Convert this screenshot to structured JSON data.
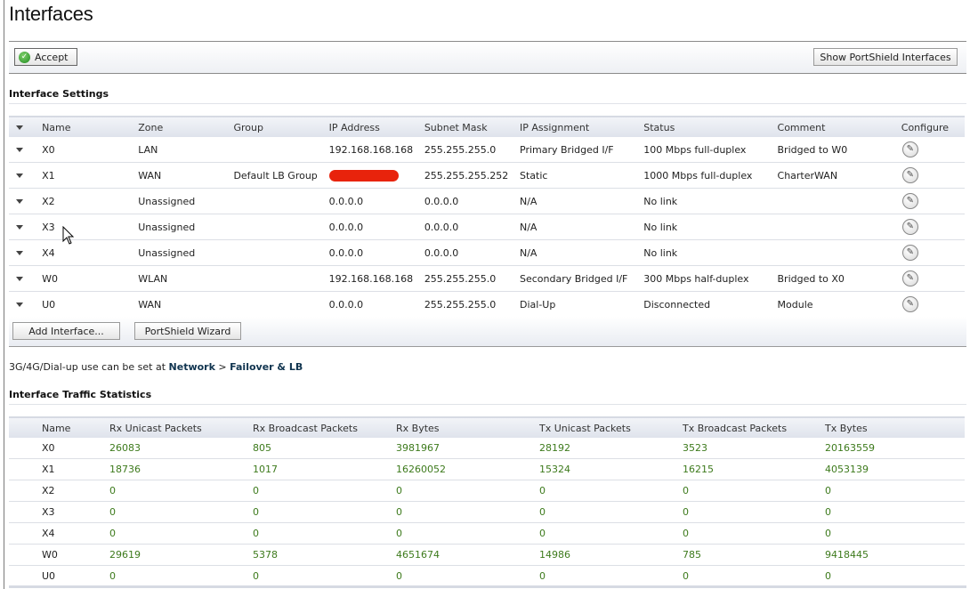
{
  "page": {
    "title": "Interfaces"
  },
  "toolbar": {
    "accept_label": "Accept",
    "show_portshield_label": "Show PortShield Interfaces"
  },
  "interface_settings": {
    "section_title": "Interface Settings",
    "columns": [
      "Name",
      "Zone",
      "Group",
      "IP Address",
      "Subnet Mask",
      "IP Assignment",
      "Status",
      "Comment",
      "Configure"
    ],
    "rows": [
      {
        "name": "X0",
        "zone": "LAN",
        "group": "",
        "ip": "192.168.168.168",
        "mask": "255.255.255.0",
        "assignment": "Primary Bridged I/F",
        "status": "100 Mbps full-duplex",
        "comment": "Bridged to W0"
      },
      {
        "name": "X1",
        "zone": "WAN",
        "group": "Default LB Group",
        "ip": "",
        "ip_redacted": true,
        "mask": "255.255.255.252",
        "assignment": "Static",
        "status": "1000 Mbps full-duplex",
        "comment": "CharterWAN"
      },
      {
        "name": "X2",
        "zone": "Unassigned",
        "group": "",
        "ip": "0.0.0.0",
        "mask": "0.0.0.0",
        "assignment": "N/A",
        "status": "No link",
        "comment": ""
      },
      {
        "name": "X3",
        "zone": "Unassigned",
        "group": "",
        "ip": "0.0.0.0",
        "mask": "0.0.0.0",
        "assignment": "N/A",
        "status": "No link",
        "comment": ""
      },
      {
        "name": "X4",
        "zone": "Unassigned",
        "group": "",
        "ip": "0.0.0.0",
        "mask": "0.0.0.0",
        "assignment": "N/A",
        "status": "No link",
        "comment": ""
      },
      {
        "name": "W0",
        "zone": "WLAN",
        "group": "",
        "ip": "192.168.168.168",
        "mask": "255.255.255.0",
        "assignment": "Secondary Bridged I/F",
        "status": "300 Mbps half-duplex",
        "comment": "Bridged to X0"
      },
      {
        "name": "U0",
        "zone": "WAN",
        "group": "",
        "ip": "0.0.0.0",
        "mask": "255.255.255.0",
        "assignment": "Dial-Up",
        "status": "Disconnected",
        "comment": "Module"
      }
    ],
    "add_interface_label": "Add Interface...",
    "portshield_wizard_label": "PortShield Wizard"
  },
  "note": {
    "text": "3G/4G/Dial-up use can be set at ",
    "link1": "Network",
    "separator": " > ",
    "link2": "Failover & LB"
  },
  "traffic_statistics": {
    "section_title": "Interface Traffic Statistics",
    "columns": [
      "Name",
      "Rx Unicast Packets",
      "Rx Broadcast Packets",
      "Rx Bytes",
      "Tx Unicast Packets",
      "Tx Broadcast Packets",
      "Tx Bytes"
    ],
    "rows": [
      {
        "name": "X0",
        "rx_unicast": "26083",
        "rx_broadcast": "805",
        "rx_bytes": "3981967",
        "tx_unicast": "28192",
        "tx_broadcast": "3523",
        "tx_bytes": "20163559"
      },
      {
        "name": "X1",
        "rx_unicast": "18736",
        "rx_broadcast": "1017",
        "rx_bytes": "16260052",
        "tx_unicast": "15324",
        "tx_broadcast": "16215",
        "tx_bytes": "4053139"
      },
      {
        "name": "X2",
        "rx_unicast": "0",
        "rx_broadcast": "0",
        "rx_bytes": "0",
        "tx_unicast": "0",
        "tx_broadcast": "0",
        "tx_bytes": "0"
      },
      {
        "name": "X3",
        "rx_unicast": "0",
        "rx_broadcast": "0",
        "rx_bytes": "0",
        "tx_unicast": "0",
        "tx_broadcast": "0",
        "tx_bytes": "0"
      },
      {
        "name": "X4",
        "rx_unicast": "0",
        "rx_broadcast": "0",
        "rx_bytes": "0",
        "tx_unicast": "0",
        "tx_broadcast": "0",
        "tx_bytes": "0"
      },
      {
        "name": "W0",
        "rx_unicast": "29619",
        "rx_broadcast": "5378",
        "rx_bytes": "4651674",
        "tx_unicast": "14986",
        "tx_broadcast": "785",
        "tx_bytes": "9418445"
      },
      {
        "name": "U0",
        "rx_unicast": "0",
        "rx_broadcast": "0",
        "rx_bytes": "0",
        "tx_unicast": "0",
        "tx_broadcast": "0",
        "tx_bytes": "0"
      }
    ]
  },
  "colors": {
    "stat_value": "#3d7a1c",
    "link": "#10344f",
    "redaction": "#e8230c",
    "accept_icon": "#1f8a21"
  }
}
